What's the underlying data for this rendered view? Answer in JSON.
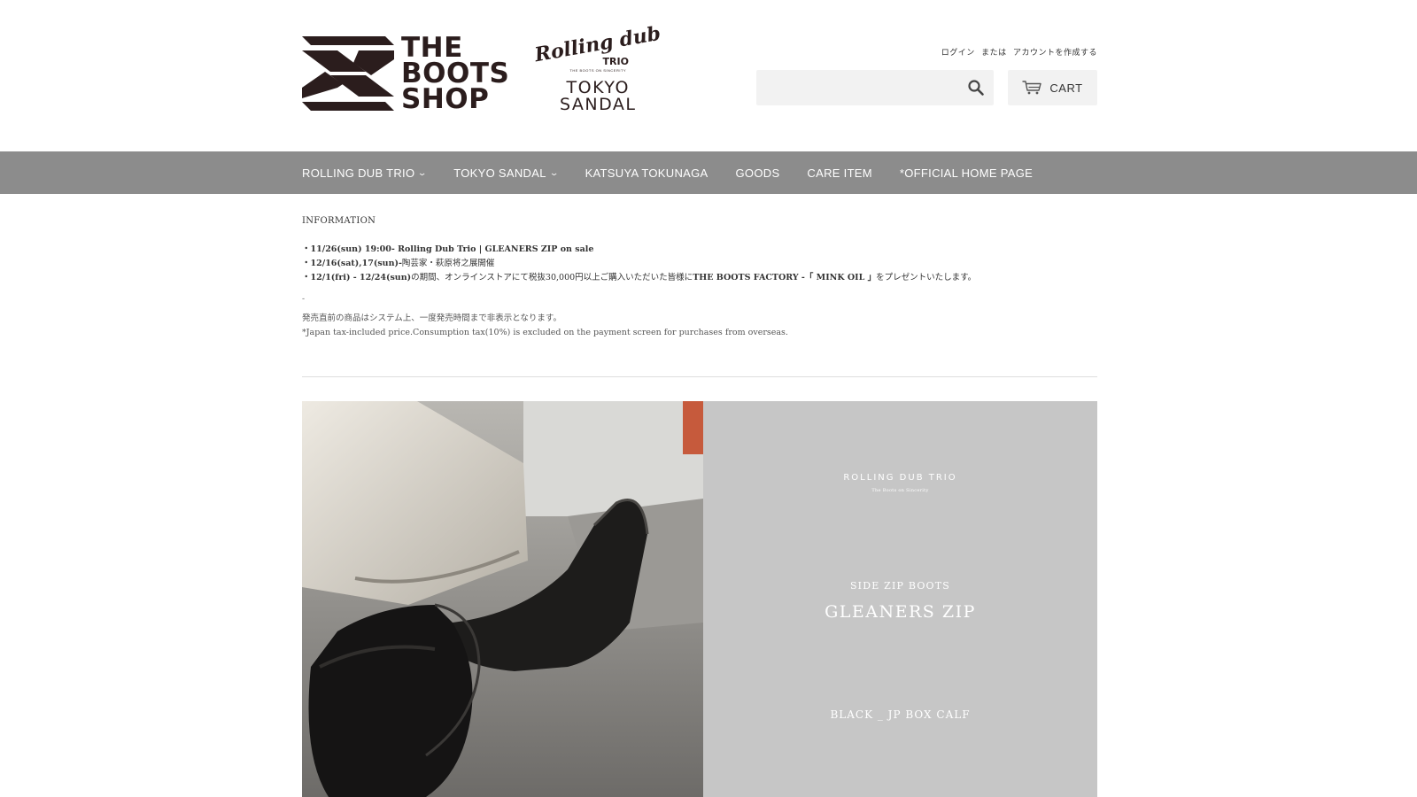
{
  "header": {
    "logo_boots": [
      "THE",
      "BOOTS",
      "SHOP"
    ],
    "logo_rdt_script": "Rolling dub",
    "logo_rdt_trio": "TRIO",
    "logo_rdt_sub": "THE BOOTS ON SINCERITY",
    "logo_tokyo_sandal": [
      "TOKYO",
      "SANDAL"
    ],
    "account": {
      "login": "ログイン",
      "or": "または",
      "create": "アカウントを作成する"
    },
    "search": {
      "placeholder": "",
      "icon": "search-icon"
    },
    "cart": {
      "label": "CART",
      "icon": "cart-icon"
    }
  },
  "nav": {
    "items": [
      {
        "label": "ROLLING DUB TRIO",
        "dropdown": true
      },
      {
        "label": "TOKYO SANDAL",
        "dropdown": true
      },
      {
        "label": "KATSUYA TOKUNAGA",
        "dropdown": false
      },
      {
        "label": "GOODS",
        "dropdown": false
      },
      {
        "label": "CARE ITEM",
        "dropdown": false
      },
      {
        "label": "*OFFICIAL HOME PAGE",
        "dropdown": false
      }
    ],
    "background": "#8c8c8c"
  },
  "information": {
    "title": "INFORMATION",
    "line1_bold": "・11/26(sun) 19:00- Rolling Dub Trio | GLEANERS ZIP on sale",
    "line2_bold": "・12/16(sat),17(sun)-",
    "line2_rest": "陶芸家・萩原将之展開催",
    "line3_bold_a": "・12/1(fri) - 12/24(sun)",
    "line3_rest_a": "の期間、オンラインストアにて税抜30,000円以上ご購入いただいた皆様に",
    "line3_bold_b": "THE BOOTS FACTORY -「 MINK OIL 」",
    "line3_rest_b": "をプレゼントいたします。",
    "dash": "-",
    "note_jp": "発売直前の商品はシステム上、一度発売時間まで非表示となります。",
    "note_en": "*Japan tax-included price.Consumption tax(10%) is excluded on the payment screen for purchases from overseas."
  },
  "hero": {
    "brand": "ROLLING DUB TRIO",
    "tagline": "The Boots on Sincerity",
    "kind": "SIDE ZIP BOOTS",
    "name": "GLEANERS ZIP",
    "color": "BLACK _ JP BOX CALF",
    "panel_bg": "#c6c6c6"
  }
}
